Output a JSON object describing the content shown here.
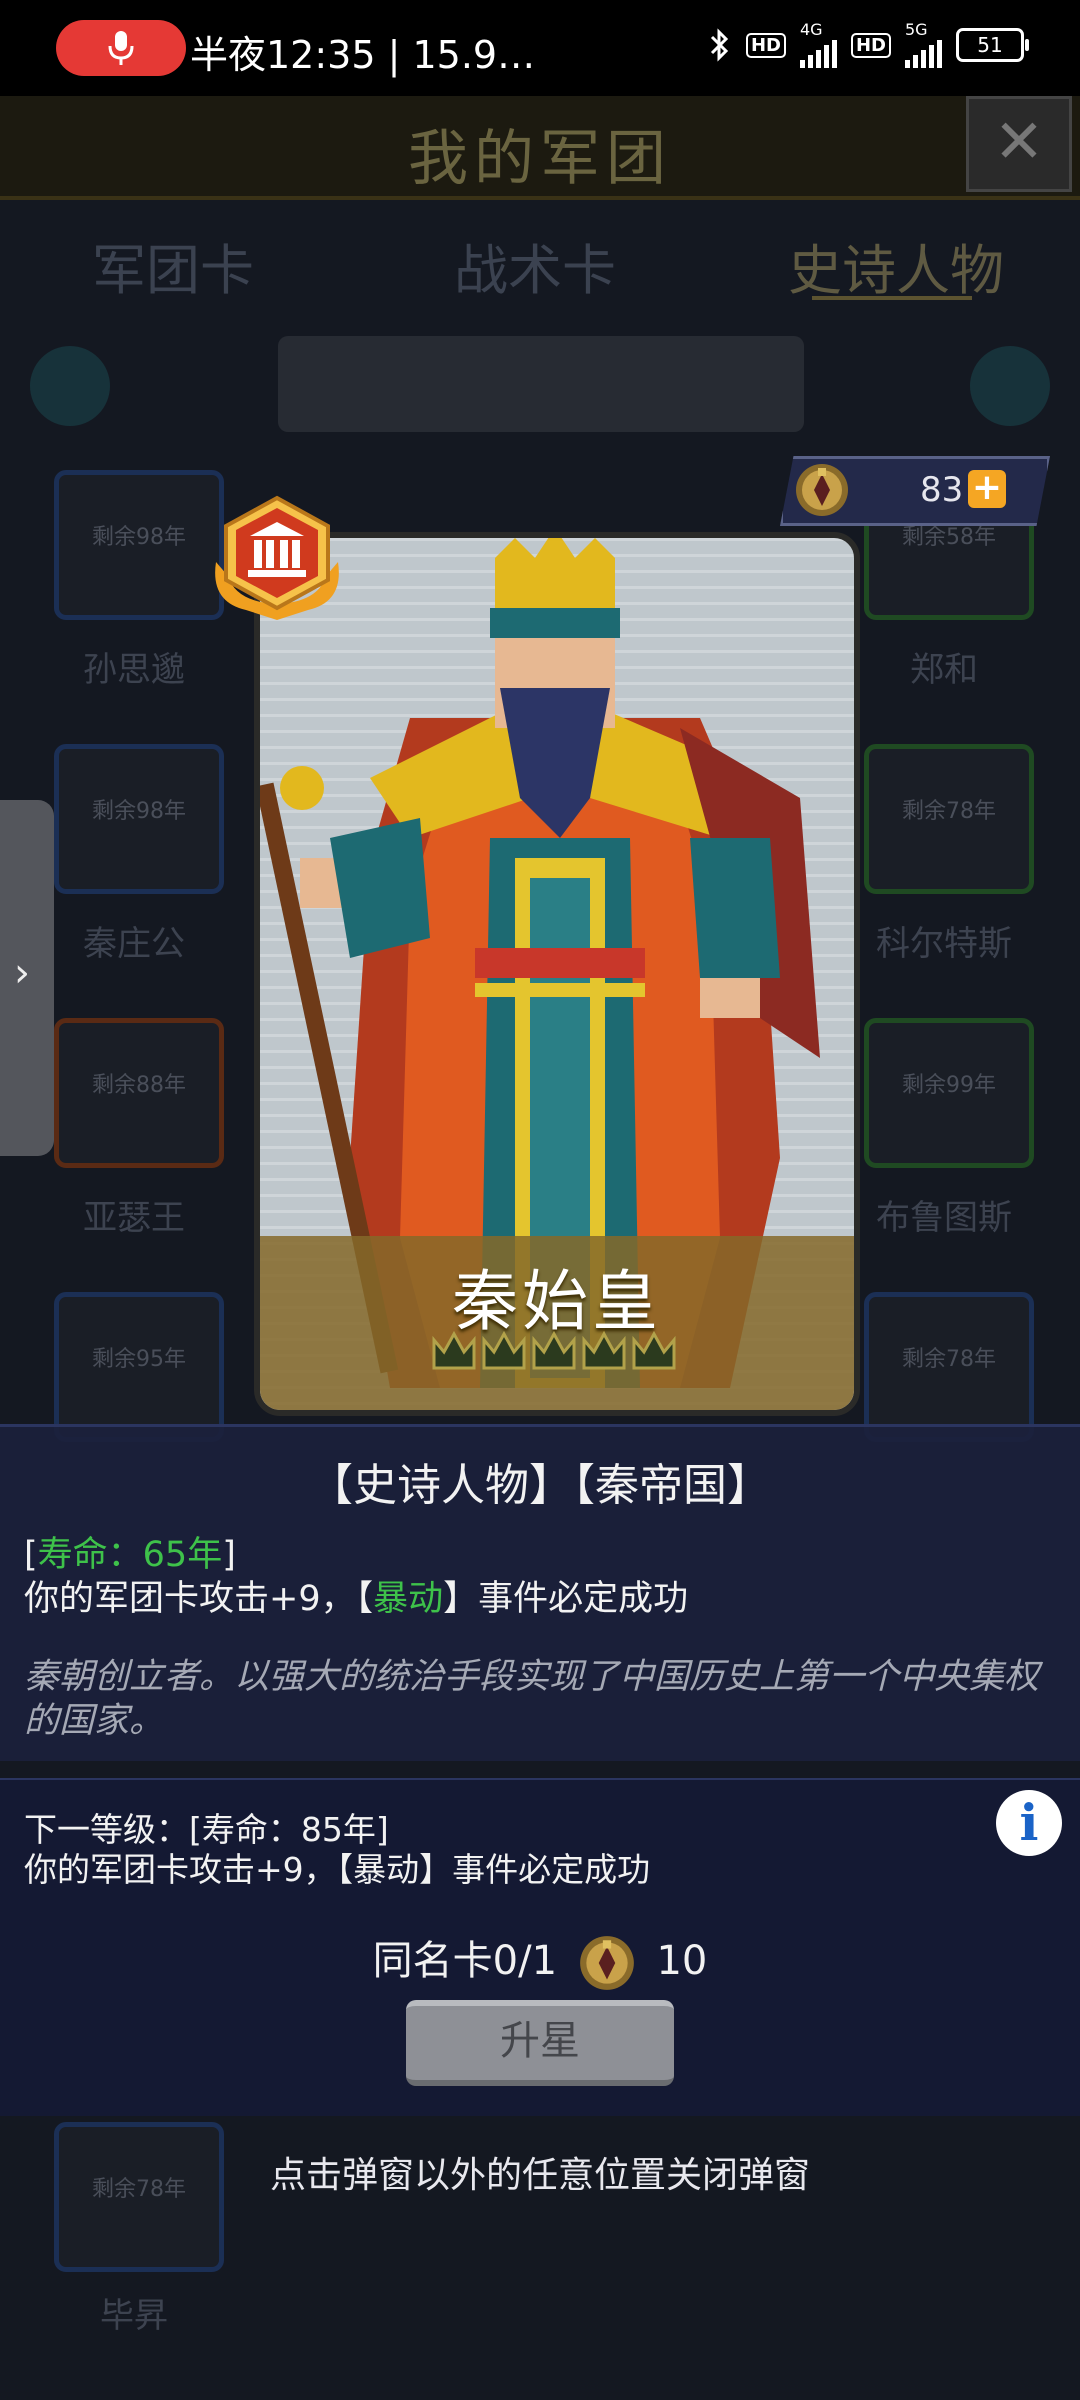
{
  "status_bar": {
    "time_text": "半夜12:35 | 15.9…",
    "network_1": "4G",
    "network_2": "5G",
    "hd_1": "HD",
    "hd_2": "HD",
    "battery": "51"
  },
  "background": {
    "title": "我的军团",
    "tabs": [
      "军团卡",
      "战术卡",
      "史诗人物"
    ],
    "active_tab": "史诗人物",
    "grid": [
      {
        "remaining": "剩余98年",
        "name": "孙思邈"
      },
      {
        "remaining": "剩余58年",
        "name": "郑和"
      },
      {
        "remaining": "剩余98年",
        "name": "秦庄公"
      },
      {
        "remaining": "剩余78年",
        "name": "科尔特斯"
      },
      {
        "remaining": "剩余88年",
        "name": "亚瑟王"
      },
      {
        "remaining": "剩余99年",
        "name": "布鲁图斯"
      },
      {
        "remaining": "剩余95年",
        "name": ""
      },
      {
        "remaining": "剩余78年",
        "name": ""
      },
      {
        "remaining": "剩余78年",
        "name": "毕昇"
      }
    ]
  },
  "popup": {
    "coin_count": "83",
    "card_name": "秦始皇",
    "star_count": 5,
    "tags": "【史诗人物】【秦帝国】",
    "lifespan_open": "[",
    "lifespan": "寿命：65年",
    "lifespan_close": "]",
    "effect_prefix": "你的军团卡攻击+9，【",
    "effect_keyword": "暴动",
    "effect_suffix": "】事件必定成功",
    "description": "秦朝创立者。以强大的统治手段实现了中国历史上第一个中央集权的国家。",
    "next_level": "下一等级：[寿命：85年]",
    "next_effect": "你的军团卡攻击+9，【暴动】事件必定成功",
    "duplicate_label": "同名卡0/1",
    "duplicate_cost": "10",
    "upgrade_button": "升星",
    "close_hint": "点击弹窗以外的任意位置关闭弹窗"
  },
  "colors": {
    "accent_green": "#3ec24a",
    "panel_bg": "#1b213c",
    "coin_plus": "#f5a623"
  }
}
